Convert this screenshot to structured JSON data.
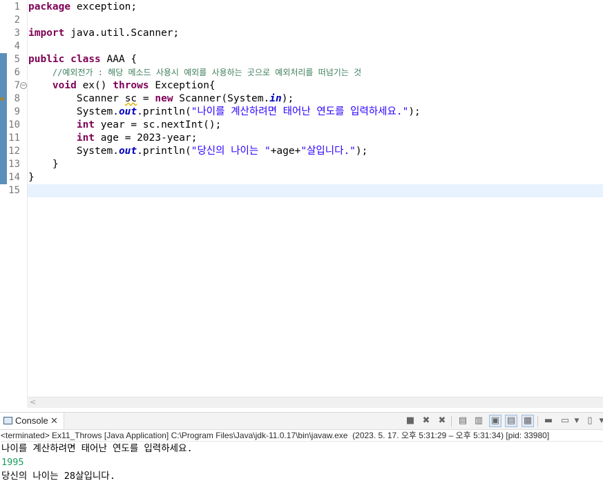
{
  "editor": {
    "lines": [
      {
        "num": "1",
        "segs": [
          {
            "t": "package",
            "c": "kw"
          },
          {
            "t": " exception;",
            "c": ""
          }
        ]
      },
      {
        "num": "2",
        "segs": []
      },
      {
        "num": "3",
        "segs": [
          {
            "t": "import",
            "c": "kw"
          },
          {
            "t": " java.util.Scanner;",
            "c": ""
          }
        ]
      },
      {
        "num": "4",
        "segs": []
      },
      {
        "num": "5",
        "segs": [
          {
            "t": "public",
            "c": "kw"
          },
          {
            "t": " ",
            "c": ""
          },
          {
            "t": "class",
            "c": "kw"
          },
          {
            "t": " AAA {",
            "c": ""
          }
        ]
      },
      {
        "num": "6",
        "segs": [
          {
            "t": "    ",
            "c": ""
          },
          {
            "t": "//예외전가 : 해당 메소드 사용시 예외를 사용하는 곳으로 예외처리를 떠넘기는 것",
            "c": "cm"
          }
        ]
      },
      {
        "num": "7",
        "segs": [
          {
            "t": "    ",
            "c": ""
          },
          {
            "t": "void",
            "c": "kw"
          },
          {
            "t": " ex() ",
            "c": ""
          },
          {
            "t": "throws",
            "c": "kw"
          },
          {
            "t": " Exception{",
            "c": ""
          }
        ]
      },
      {
        "num": "8",
        "segs": [
          {
            "t": "        Scanner ",
            "c": ""
          },
          {
            "t": "sc",
            "c": "warn-var"
          },
          {
            "t": " = ",
            "c": ""
          },
          {
            "t": "new",
            "c": "kw"
          },
          {
            "t": " Scanner(System.",
            "c": ""
          },
          {
            "t": "in",
            "c": "st-field"
          },
          {
            "t": ");",
            "c": ""
          }
        ]
      },
      {
        "num": "9",
        "segs": [
          {
            "t": "        System.",
            "c": ""
          },
          {
            "t": "out",
            "c": "st-field"
          },
          {
            "t": ".println(",
            "c": ""
          },
          {
            "t": "\"나이를 계산하려면 태어난 연도를 입력하세요.\"",
            "c": "str"
          },
          {
            "t": ");",
            "c": ""
          }
        ]
      },
      {
        "num": "10",
        "segs": [
          {
            "t": "        ",
            "c": ""
          },
          {
            "t": "int",
            "c": "kw"
          },
          {
            "t": " year = sc.nextInt();",
            "c": ""
          }
        ]
      },
      {
        "num": "11",
        "segs": [
          {
            "t": "        ",
            "c": ""
          },
          {
            "t": "int",
            "c": "kw"
          },
          {
            "t": " age = 2023-year;",
            "c": ""
          }
        ]
      },
      {
        "num": "12",
        "segs": [
          {
            "t": "        System.",
            "c": ""
          },
          {
            "t": "out",
            "c": "st-field"
          },
          {
            "t": ".println(",
            "c": ""
          },
          {
            "t": "\"당신의 나이는 \"",
            "c": "str"
          },
          {
            "t": "+age+",
            "c": ""
          },
          {
            "t": "\"살입니다.\"",
            "c": "str"
          },
          {
            "t": ");",
            "c": ""
          }
        ]
      },
      {
        "num": "13",
        "segs": [
          {
            "t": "    }",
            "c": ""
          }
        ]
      },
      {
        "num": "14",
        "segs": [
          {
            "t": "}",
            "c": ""
          }
        ]
      },
      {
        "num": "15",
        "segs": []
      }
    ]
  },
  "console": {
    "tab_label": "Console",
    "tab_close": "✕",
    "toolbar_icons": [
      "terminate-icon",
      "remove-launch-icon",
      "remove-all-icon",
      "scroll-lock-icon",
      "word-wrap-icon",
      "show-on-stdout-icon",
      "show-on-stderr-icon",
      "pin-console-icon",
      "display-console-icon",
      "open-console-icon"
    ],
    "status": "<terminated> Ex11_Throws [Java Application] C:\\Program Files\\Java\\jdk-11.0.17\\bin\\javaw.exe  (2023. 5. 17. 오후 5:31:29 – 오후 5:31:34) [pid: 33980]",
    "output": [
      {
        "text": "나이를 계산하려면 태어난 연도를 입력하세요.",
        "type": "stdout"
      },
      {
        "text": "1995",
        "type": "stdin"
      },
      {
        "text": "당신의 나이는 28살입니다.",
        "type": "stdout"
      }
    ]
  },
  "colors": {
    "keyword": "#7f0055",
    "comment": "#3f7f5f",
    "string": "#2a00ff",
    "static_field": "#0000c0",
    "stdin": "#1a9b5a",
    "change_bar": "#5b8fb9"
  }
}
